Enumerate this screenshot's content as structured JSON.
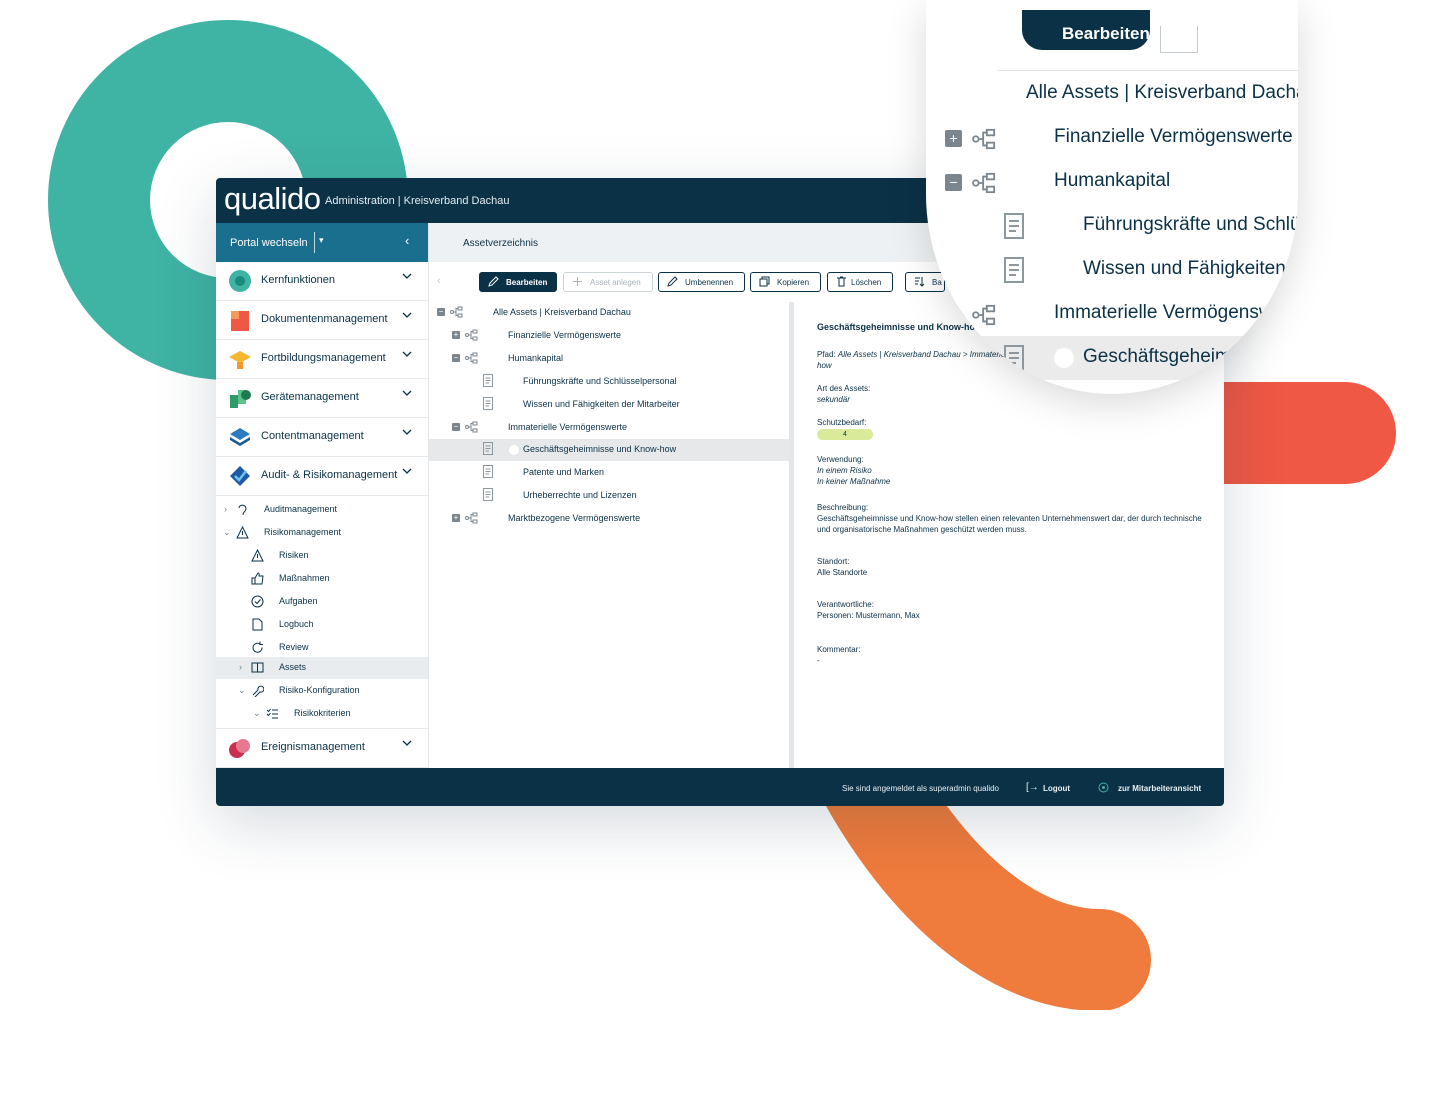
{
  "app": {
    "logo": "qualido",
    "title": "Administration | Kreisverband Dachau",
    "colors": {
      "navy": "#0b3146",
      "teal_bar": "#1a6e8e",
      "accent_teal": "#3fb3a4",
      "accent_red": "#ee5845",
      "accent_orange": "#ef7b3c",
      "level_green": "#d9ea9a"
    }
  },
  "sidebar": {
    "portal_switch": "Portal wechseln",
    "modules": [
      {
        "label": "Kernfunktionen",
        "icon": "kernfunktionen-icon"
      },
      {
        "label": "Dokumentenmanagement",
        "icon": "document-icon"
      },
      {
        "label": "Fortbildungsmanagement",
        "icon": "graduation-cap-icon"
      },
      {
        "label": "Gerätemanagement",
        "icon": "device-icon"
      },
      {
        "label": "Contentmanagement",
        "icon": "layers-icon"
      },
      {
        "label": "Audit- & Risikomanagement",
        "icon": "audit-check-icon"
      },
      {
        "label": "Ereignismanagement",
        "icon": "event-icon"
      }
    ],
    "sub_items": [
      {
        "label": "Auditmanagement",
        "icon": "ear-icon"
      },
      {
        "label": "Risikomanagement",
        "icon": "warning-icon"
      },
      {
        "label": "Risiken",
        "icon": "warning-icon"
      },
      {
        "label": "Maßnahmen",
        "icon": "thumbs-up-icon"
      },
      {
        "label": "Aufgaben",
        "icon": "check-circle-icon"
      },
      {
        "label": "Logbuch",
        "icon": "log-file-icon"
      },
      {
        "label": "Review",
        "icon": "refresh-icon"
      },
      {
        "label": "Assets",
        "icon": "book-icon"
      },
      {
        "label": "Risiko-Konfiguration",
        "icon": "wrench-icon"
      },
      {
        "label": "Risikokriterien",
        "icon": "checklist-icon"
      }
    ]
  },
  "main": {
    "breadcrumb": "Assetverzeichnis",
    "toolbar": {
      "edit": "Bearbeiten",
      "create": "Asset anlegen",
      "rename": "Umbenennen",
      "copy": "Kopieren",
      "delete": "Löschen",
      "more": "Ba"
    },
    "tree": [
      {
        "label": "Alle Assets | Kreisverband Dachau",
        "toggle": "−"
      },
      {
        "label": "Finanzielle Vermögenswerte",
        "toggle": "+"
      },
      {
        "label": "Humankapital",
        "toggle": "−"
      },
      {
        "label": "Führungskräfte und Schlüsselpersonal"
      },
      {
        "label": "Wissen und Fähigkeiten der Mitarbeiter"
      },
      {
        "label": "Immaterielle Vermögenswerte",
        "toggle": "−"
      },
      {
        "label": "Geschäftsgeheimnisse und Know-how"
      },
      {
        "label": "Patente und Marken"
      },
      {
        "label": "Urheberrechte und Lizenzen"
      },
      {
        "label": "Marktbezogene Vermögenswerte",
        "toggle": "+"
      }
    ],
    "detail": {
      "title": "Geschäftsgeheimnisse und Know-how",
      "path_label": "Pfad:",
      "path_value": "Alle Assets | Kreisverband Dachau > Immaterielle Vermögenswerte > Geschäftsgeheimnisse und Know-how",
      "path_line2": "Know-how",
      "type_label": "Art des Assets:",
      "type_value": "sekundär",
      "protection_label": "Schutzbedarf:",
      "protection_value": "4",
      "usage_label": "Verwendung:",
      "usage_1": "In einem Risiko",
      "usage_2": "In keiner Maßnahme",
      "desc_label": "Beschreibung:",
      "desc_value": "Geschäftsgeheimnisse und Know-how stellen einen relevanten Unternehmenswert dar, der durch technische und organisatorische Maßnahmen geschützt werden muss.",
      "location_label": "Standort:",
      "location_value": "Alle Standorte",
      "responsible_label": "Verantwortliche:",
      "responsible_value": "Personen: Mustermann, Max",
      "comment_label": "Kommentar:",
      "comment_value": "-"
    }
  },
  "footer": {
    "logged_in": "Sie sind angemeldet als superadmin qualido",
    "logout": "Logout",
    "employee_view": "zur Mitarbeiteransicht"
  },
  "magnifier": {
    "edit_partial": "Bearbeiten",
    "rows": [
      {
        "label": "Alle Assets | Kreisverband Dachau"
      },
      {
        "label": "Finanzielle Vermögenswerte",
        "toggle": "+"
      },
      {
        "label": "Humankapital",
        "toggle": "−"
      },
      {
        "label": "Führungskräfte und Schlüsselpersonal"
      },
      {
        "label": "Wissen und Fähigkeiten der Mitarbeiter"
      },
      {
        "label": "Immaterielle Vermögenswerte"
      },
      {
        "label": "Geschäftsgeheimnisse und Know-how"
      }
    ]
  }
}
